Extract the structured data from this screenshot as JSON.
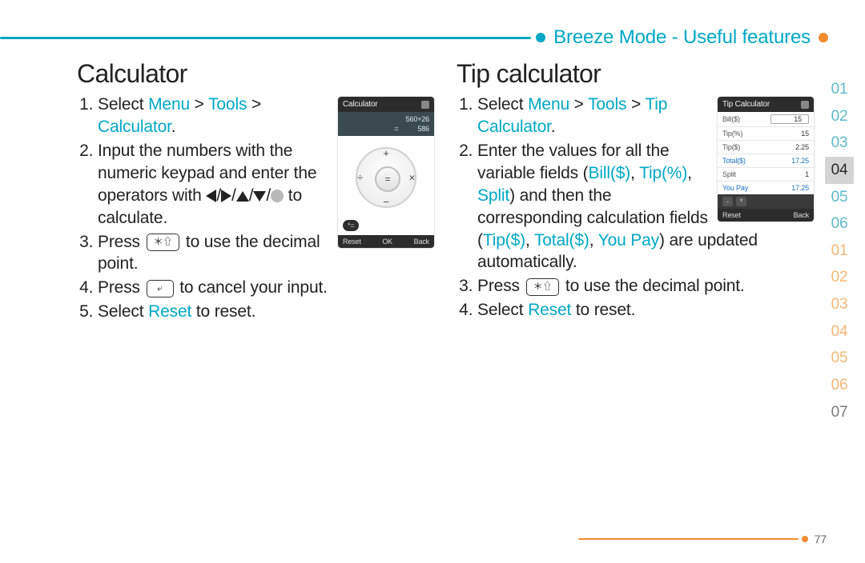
{
  "header": {
    "breadcrumb": "Breeze Mode - Useful features"
  },
  "left": {
    "title": "Calculator",
    "phone": {
      "title": "Calculator",
      "expr": "560+26",
      "eq": "=",
      "result": "586",
      "ops": {
        "up": "+",
        "down": "−",
        "left": "÷",
        "right": "×",
        "center": "="
      },
      "extra": "*=",
      "footer_left": "Reset",
      "footer_mid": "OK",
      "footer_right": "Back"
    },
    "steps": {
      "s1_a": "Select ",
      "s1_menu": "Menu",
      "s1_gt1": " > ",
      "s1_tools": "Tools",
      "s1_gt2": " > ",
      "s1_calc": "Calculator",
      "s1_period": ".",
      "s2_a": "Input the numbers with the numeric keypad and enter the operators with ",
      "s2_slash": "/",
      "s2_b": " to calculate.",
      "s3_a": "Press ",
      "s3_key": "＊⇧",
      "s3_b": " to use the decimal point.",
      "s4_a": "Press ",
      "s4_key": "⤶",
      "s4_b": " to cancel your input.",
      "s5_a": "Select ",
      "s5_reset": "Reset",
      "s5_b": " to reset."
    }
  },
  "right": {
    "title": "Tip calculator",
    "phone": {
      "title": "Tip Calculator",
      "rows": [
        {
          "label": "Bill($)",
          "value": "15",
          "labelClass": "",
          "valClass": "boxed"
        },
        {
          "label": "Tip(%)",
          "value": "15",
          "labelClass": "",
          "valClass": ""
        },
        {
          "label": "Tip($)",
          "value": "2.25",
          "labelClass": "",
          "valClass": ""
        },
        {
          "label": "Total($)",
          "value": "17.25",
          "labelClass": "teal",
          "valClass": "teal"
        },
        {
          "label": "Split",
          "value": "1",
          "labelClass": "",
          "valClass": ""
        },
        {
          "label": "You Pay",
          "value": "17.25",
          "labelClass": "teal",
          "valClass": "teal"
        }
      ],
      "split_pill_a": "-",
      "split_pill_b": "*",
      "footer_left": "Reset",
      "footer_right": "Back"
    },
    "steps": {
      "s1_a": "Select ",
      "s1_menu": "Menu",
      "s1_gt1": " > ",
      "s1_tools": "Tools",
      "s1_gt2": " > ",
      "s1_tip": "Tip Calculator",
      "s1_period": ".",
      "s2_a": "Enter the values for all the variable fields (",
      "s2_bill": "Bill($)",
      "s2_c1": ", ",
      "s2_tipp": "Tip(%)",
      "s2_c2": ", ",
      "s2_split": "Split",
      "s2_b": ") and then the corresponding calculation fields (",
      "s2_tipd": "Tip($)",
      "s2_c3": ", ",
      "s2_total": "Total($)",
      "s2_c4": ", ",
      "s2_youpay": "You Pay",
      "s2_c": ") are updated automatically.",
      "s3_a": "Press ",
      "s3_key": "＊⇧",
      "s3_b": " to use the decimal point.",
      "s4_a": "Select ",
      "s4_reset": "Reset",
      "s4_b": " to reset."
    }
  },
  "tabs": {
    "top": [
      "01",
      "02",
      "03",
      "04",
      "05",
      "06"
    ],
    "top_active": "04",
    "bottom": [
      "01",
      "02",
      "03",
      "04",
      "05",
      "06",
      "07"
    ]
  },
  "page_number": "77"
}
